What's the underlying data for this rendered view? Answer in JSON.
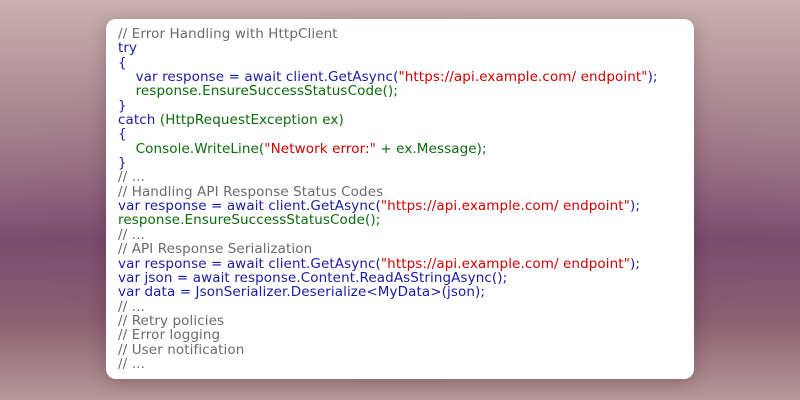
{
  "code": {
    "lines": [
      [
        {
          "t": "// Error Handling with HttpClient",
          "c": "c"
        }
      ],
      [
        {
          "t": "try",
          "c": "k"
        }
      ],
      [
        {
          "t": "{",
          "c": "k"
        }
      ],
      [
        {
          "t": "    var response = await client.GetAsync(",
          "c": "k"
        },
        {
          "t": "\"https://api.example.com/ endpoint\"",
          "c": "s"
        },
        {
          "t": ");",
          "c": "k"
        }
      ],
      [
        {
          "t": "    response.EnsureSuccessStatusCode();",
          "c": "g"
        }
      ],
      [
        {
          "t": "}",
          "c": "k"
        }
      ],
      [
        {
          "t": "catch ",
          "c": "k"
        },
        {
          "t": "(HttpRequestException ex)",
          "c": "g"
        }
      ],
      [
        {
          "t": "{",
          "c": "k"
        }
      ],
      [
        {
          "t": "    Console.WriteLine(",
          "c": "g"
        },
        {
          "t": "\"Network error:\"",
          "c": "s"
        },
        {
          "t": " + ex.Message);",
          "c": "g"
        }
      ],
      [
        {
          "t": "}",
          "c": "k"
        }
      ],
      [
        {
          "t": "// ...",
          "c": "c"
        }
      ],
      [
        {
          "t": "// Handling API Response Status Codes",
          "c": "c"
        }
      ],
      [
        {
          "t": "var response = await client.GetAsync(",
          "c": "k"
        },
        {
          "t": "\"https://api.example.com/ endpoint\"",
          "c": "s"
        },
        {
          "t": ");",
          "c": "k"
        }
      ],
      [
        {
          "t": "response.EnsureSuccessStatusCode();",
          "c": "g"
        }
      ],
      [
        {
          "t": "// ...",
          "c": "c"
        }
      ],
      [
        {
          "t": "// API Response Serialization",
          "c": "c"
        }
      ],
      [
        {
          "t": "var response = await client.GetAsync(",
          "c": "k"
        },
        {
          "t": "\"https://api.example.com/ endpoint\"",
          "c": "s"
        },
        {
          "t": ");",
          "c": "k"
        }
      ],
      [
        {
          "t": "var json = await response.Content.ReadAsStringAsync();",
          "c": "k"
        }
      ],
      [
        {
          "t": "var data = JsonSerializer.Deserialize<MyData>(json);",
          "c": "k"
        }
      ],
      [
        {
          "t": "// ...",
          "c": "c"
        }
      ],
      [
        {
          "t": "// Retry policies",
          "c": "c"
        }
      ],
      [
        {
          "t": "// Error logging",
          "c": "c"
        }
      ],
      [
        {
          "t": "// User notification",
          "c": "c"
        }
      ],
      [
        {
          "t": "// ...",
          "c": "c"
        }
      ]
    ]
  },
  "colors": {
    "comment": "#6b6b6b",
    "keyword": "#1b1ba6",
    "identifier": "#0b6b0b",
    "string": "#d00000",
    "card": "#ffffff"
  }
}
